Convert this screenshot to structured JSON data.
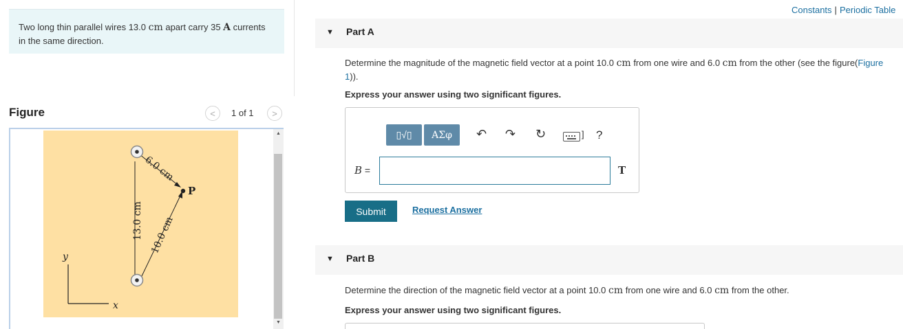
{
  "problem": {
    "text_part1": "Two long thin parallel wires 13.0 ",
    "unit_cm": "cm",
    "text_part2": " apart carry 35 ",
    "unit_A": "A",
    "text_part3": " currents in the same direction."
  },
  "figure": {
    "title": "Figure",
    "pager": "1 of 1",
    "prev_glyph": "<",
    "next_glyph": ">",
    "labels": {
      "d1": "6.0 cm",
      "d2": "10.0 cm",
      "sep": "13.0 cm",
      "point": "P",
      "y_axis": "y",
      "x_axis": "x"
    }
  },
  "links": {
    "constants": "Constants",
    "separator": "|",
    "periodic": "Periodic Table"
  },
  "part_a": {
    "title": "Part A",
    "prompt_1": "Determine the magnitude of the magnetic field vector at a point 10.0 ",
    "unit_1": "cm",
    "prompt_2": " from one wire and 6.0 ",
    "unit_2": "cm",
    "prompt_3": " from the other (see the figure(",
    "figure_link": "Figure 1",
    "prompt_4": ")).",
    "instruction": "Express your answer using two significant figures.",
    "toolbar": {
      "template_label": "▯√▯",
      "greek_label": "ΑΣφ",
      "undo": "↶",
      "redo": "↷",
      "reset": "↻",
      "keyboard_bracket": "]",
      "help": "?"
    },
    "variable": "B",
    "equals": " =",
    "input_value": "",
    "unit": "T",
    "submit_label": "Submit",
    "request_label": "Request Answer"
  },
  "part_b": {
    "title": "Part B",
    "prompt_1": "Determine the direction of the magnetic field vector at a point 10.0 ",
    "unit_1": "cm",
    "prompt_2": " from one wire and 6.0 ",
    "unit_2": "cm",
    "prompt_3": " from the other.",
    "instruction": "Express your answer using two significant figures."
  },
  "colors": {
    "accent": "#186e87",
    "link": "#1b6fa0",
    "problem_bg": "#e9f6f8",
    "figure_bg": "#fee0a3",
    "toolbar_btn": "#5f8aa8"
  }
}
